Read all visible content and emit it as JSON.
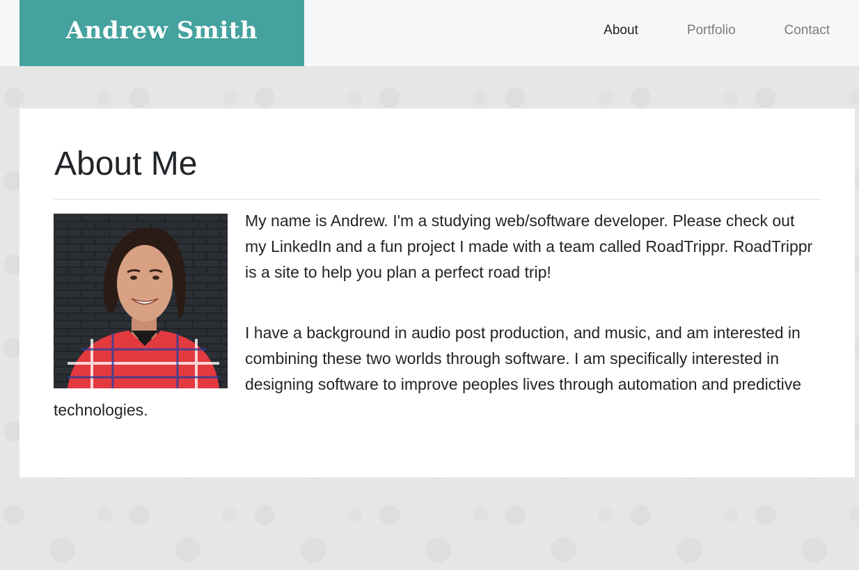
{
  "header": {
    "brand": "Andrew Smith",
    "nav": [
      {
        "label": "About",
        "active": true
      },
      {
        "label": "Portfolio",
        "active": false
      },
      {
        "label": "Contact",
        "active": false
      }
    ]
  },
  "about": {
    "title": "About Me",
    "paragraphs": [
      "My name is Andrew. I'm a studying web/software developer. Please check out my LinkedIn and a fun project I made with a team called RoadTrippr. RoadTrippr is a site to help you plan a perfect road trip!",
      "I have a background in audio post production, and music, and am interested in combining these two worlds through software. I am specifically interested in designing software to improve peoples lives through automation and predictive technologies."
    ]
  },
  "colors": {
    "brand_bg": "#45a29e",
    "nav_bg": "#f6f7f9",
    "page_bg": "#e6e6e6"
  }
}
